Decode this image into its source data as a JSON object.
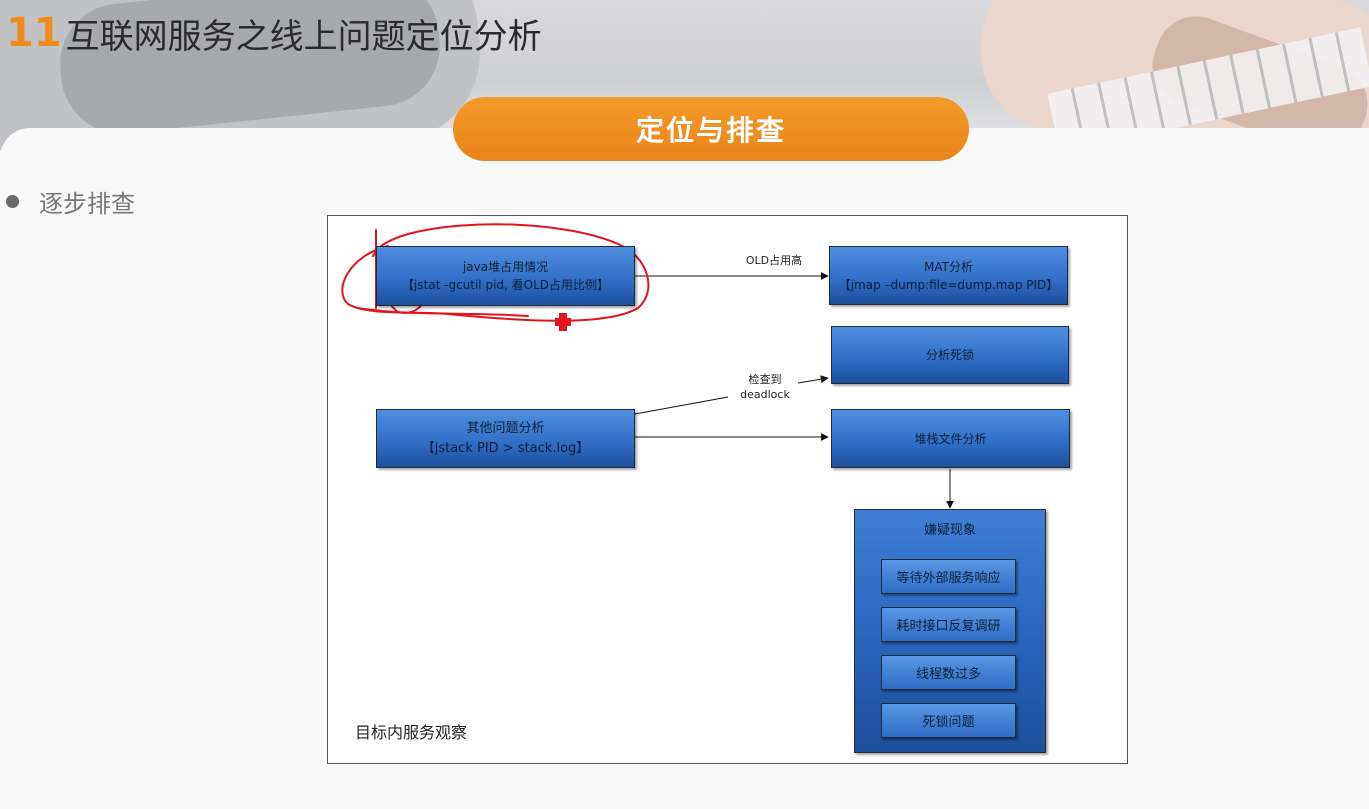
{
  "slide": {
    "number": "11",
    "title": "互联网服务之线上问题定位分析",
    "section": "定位与排查",
    "bullet": "逐步排查"
  },
  "diagram": {
    "nodes": {
      "java_heap": {
        "line1": "java堆占用情况",
        "line2": "【jstat -gcutil pid, 看OLD占用比例】"
      },
      "mat": {
        "line1": "MAT分析",
        "line2": "【jmap –dump:file=dump.map PID】"
      },
      "deadlock": {
        "line1": "分析死锁"
      },
      "other": {
        "line1": "其他问题分析",
        "line2": "【jstack PID > stack.log】"
      },
      "stack_file": {
        "line1": "堆栈文件分析"
      }
    },
    "edges": {
      "old_high": "OLD占用高",
      "check_line1": "检查到",
      "check_line2": "deadlock"
    },
    "suspects": {
      "title": "嫌疑现象",
      "items": [
        "等待外部服务响应",
        "耗时接口反复调研",
        "线程数过多",
        "死锁问题"
      ]
    },
    "caption": "目标内服务观察"
  },
  "colors": {
    "accent": "#f08c1e",
    "node_blue": "#2f6cc4",
    "annotation_red": "#e0141e"
  }
}
